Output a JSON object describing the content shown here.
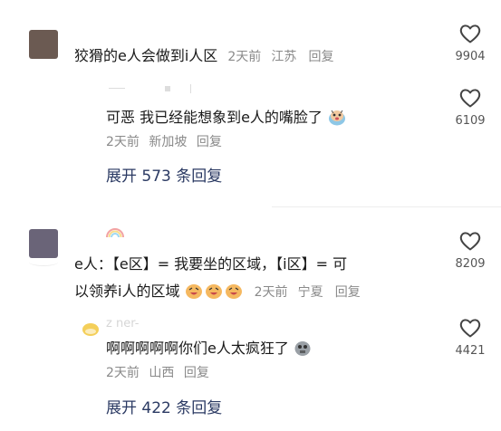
{
  "comments": [
    {
      "text": "狡猾的e人会做到i人区",
      "time": "2天前",
      "location": "江苏",
      "reply_label": "回复",
      "likes": "9904",
      "avatar_color": "#6b5a52"
    },
    {
      "text_line1": "e人：【e区】= 我要坐的区域，【i区】= 可",
      "text_line2": "以领养i人的区域",
      "time": "2天前",
      "location": "宁夏",
      "reply_label": "回复",
      "likes": "8209",
      "avatar_color": "#6a6478"
    }
  ],
  "replies": [
    {
      "text": "可恶 我已经能想象到e人的嘴脸了",
      "time": "2天前",
      "location": "新加坡",
      "reply_label": "回复",
      "likes": "6109",
      "emoji_icon": "scared-face-icon"
    },
    {
      "name_fragment": "z    ner-",
      "text": "啊啊啊啊啊你们e人太疯狂了",
      "time": "2天前",
      "location": "山西",
      "reply_label": "回复",
      "likes": "4421",
      "emoji_icon": "skull-face-icon"
    }
  ],
  "expand_replies": [
    {
      "label": "展开 573 条回复"
    },
    {
      "label": "展开 422 条回复"
    }
  ],
  "colors": {
    "expand_link": "#2b3a63",
    "meta_gray": "#8a8a8a",
    "heart_outline": "#444444"
  }
}
